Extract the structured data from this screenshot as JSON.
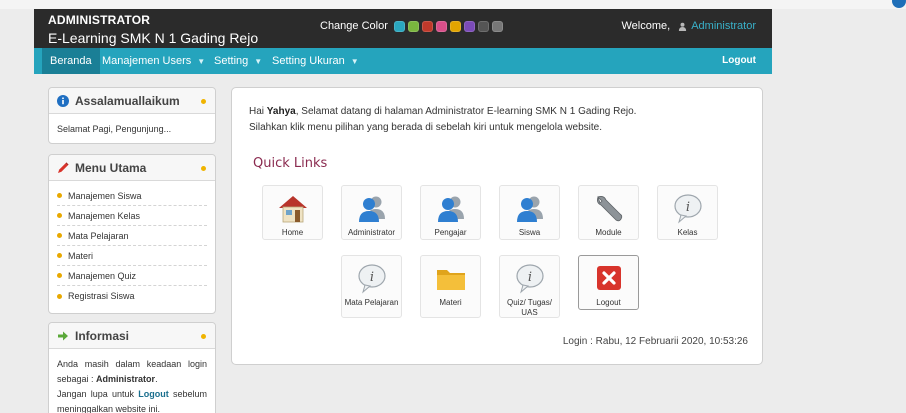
{
  "header": {
    "role": "ADMINISTRATOR",
    "site_title": "E-Learning SMK N 1 Gading Rejo",
    "change_color_label": "Change Color",
    "swatches": [
      "#2aa7bf",
      "#7ab63e",
      "#c0392b",
      "#d94f8a",
      "#e2a400",
      "#7b4bb8",
      "#555555",
      "#777777"
    ],
    "welcome_label": "Welcome,",
    "username": "Administrator"
  },
  "nav": {
    "items": [
      {
        "label": "Beranda"
      },
      {
        "label": "Manajemen Users"
      },
      {
        "label": "Setting"
      },
      {
        "label": "Setting Ukuran"
      }
    ],
    "logout_label": "Logout"
  },
  "sidebar": {
    "greeting": {
      "title": "Assalamuallaikum",
      "body": "Selamat Pagi, Pengunjung..."
    },
    "menu": {
      "title": "Menu Utama",
      "items": [
        "Manajemen Siswa",
        "Manajemen Kelas",
        "Mata Pelajaran",
        "Materi",
        "Manajemen Quiz",
        "Registrasi Siswa"
      ]
    },
    "info": {
      "title": "Informasi",
      "line1": "Anda masih dalam keadaan login sebagai :",
      "role": "Administrator",
      "line2_a": "Jangan lupa untuk",
      "logout_word": "Logout",
      "line2_b": "sebelum meninggalkan website ini."
    }
  },
  "main": {
    "greet_prefix": "Hai",
    "greet_name": "Yahya",
    "greet_rest": ", Selamat datang di halaman Administrator E-learning SMK N 1 Gading Rejo.",
    "greet_line2": "Silahkan klik menu pilihan yang berada di sebelah kiri untuk mengelola website.",
    "quick_links_title": "Quick Links",
    "tiles": [
      {
        "label": "Home",
        "icon": "home-icon"
      },
      {
        "label": "Administrator",
        "icon": "users-icon"
      },
      {
        "label": "Pengajar",
        "icon": "users-icon"
      },
      {
        "label": "Siswa",
        "icon": "users-icon"
      },
      {
        "label": "Module",
        "icon": "wrench-icon"
      },
      {
        "label": "Kelas",
        "icon": "info-icon"
      },
      {
        "label": "Mata Pelajaran",
        "icon": "info-icon"
      },
      {
        "label": "Materi",
        "icon": "folder-icon"
      },
      {
        "label": "Quiz/ Tugas/ UAS",
        "icon": "info-icon"
      },
      {
        "label": "Logout",
        "icon": "close-icon"
      }
    ],
    "login_info": "Login : Rabu, 12 Februarii 2020, 10:53:26"
  }
}
